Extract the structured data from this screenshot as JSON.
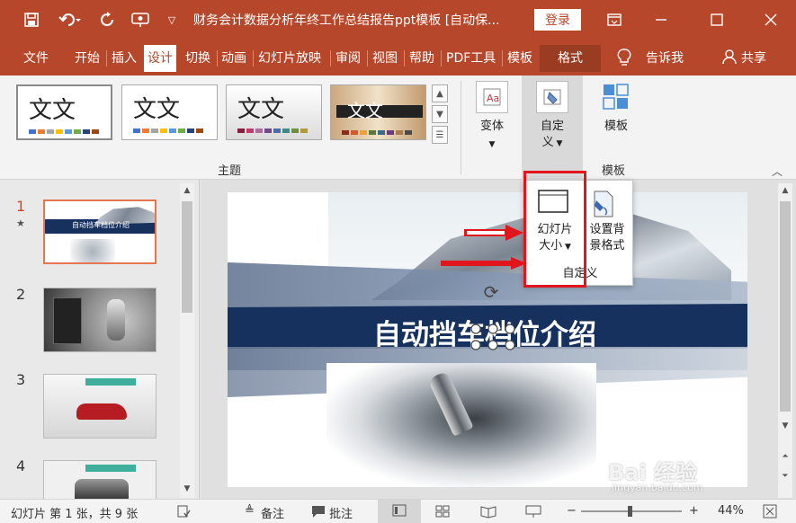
{
  "titlebar": {
    "doc_title": "财务会计数据分析年终工作总结报告ppt模板 [自动保...",
    "login_label": "登录",
    "save_icon": "save-icon",
    "undo_icon": "undo-icon",
    "redo_icon": "redo-icon"
  },
  "tabs": [
    {
      "label": "文件"
    },
    {
      "label": "开始"
    },
    {
      "label": "插入"
    },
    {
      "label": "设计"
    },
    {
      "label": "切换"
    },
    {
      "label": "动画"
    },
    {
      "label": "幻灯片放映"
    },
    {
      "label": "审阅"
    },
    {
      "label": "视图"
    },
    {
      "label": "帮助"
    },
    {
      "label": "PDF工具"
    },
    {
      "label": "模板"
    },
    {
      "label": "格式"
    }
  ],
  "tell_me": "告诉我",
  "share": "共享",
  "ribbon": {
    "theme_sample": "文文",
    "theme_sample_4": "文文",
    "group_theme": "主题",
    "variant_label": "变体",
    "customize_label_1": "自定",
    "customize_label_2": "义",
    "template_label": "模板",
    "group_template": "模板"
  },
  "popup": {
    "slide_size_1": "幻灯片",
    "slide_size_2": "大小",
    "bg_format_1": "设置背",
    "bg_format_2": "景格式",
    "group_label": "自定义"
  },
  "slides": [
    {
      "num": "1"
    },
    {
      "num": "2"
    },
    {
      "num": "3"
    },
    {
      "num": "4"
    }
  ],
  "thumb1_title": "自动挡车档位介绍",
  "slide_title": "自动挡车档位介绍",
  "statusbar": {
    "slide_info": "幻灯片 第 1 张，共 9 张",
    "notes": "备注",
    "comments": "批注",
    "zoom": "44%"
  },
  "watermark": "Bai 经验",
  "watermark_sub": "jingyan.baidu.com",
  "colors": {
    "accent": "#b7472a",
    "highlight_red": "#e0161c",
    "slide_navy": "#17315f"
  }
}
